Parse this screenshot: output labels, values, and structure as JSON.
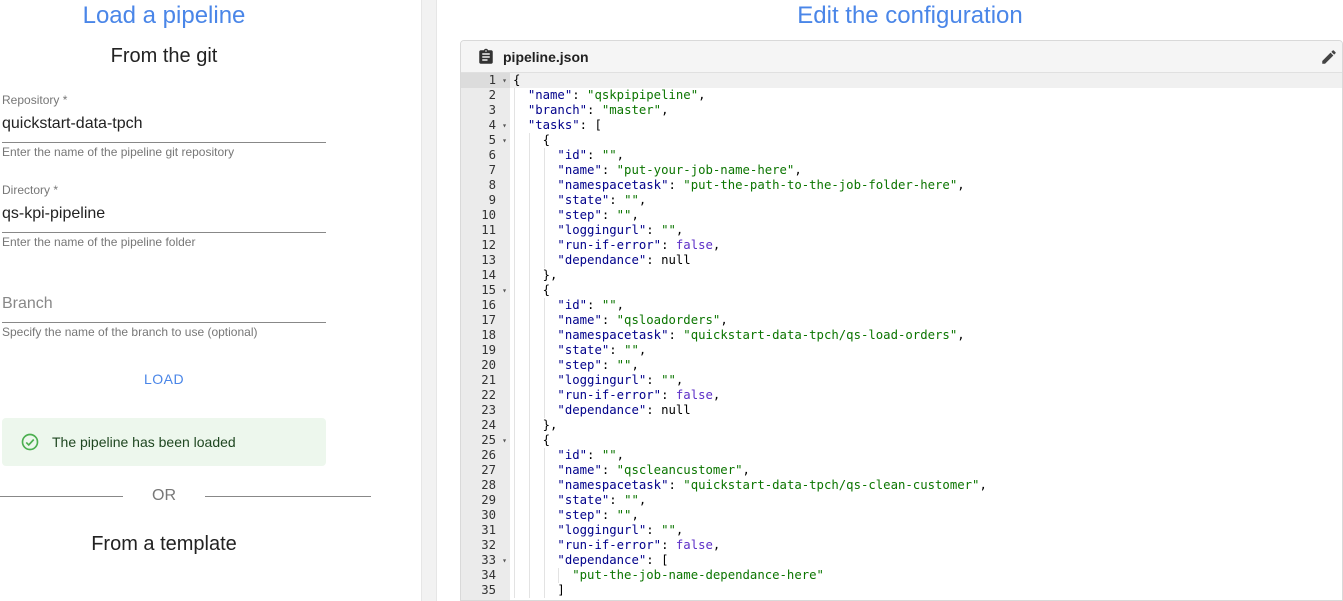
{
  "left": {
    "title": "Load a pipeline",
    "git_title": "From the git",
    "repository": {
      "label": "Repository *",
      "value": "quickstart-data-tpch",
      "helper": "Enter the name of the pipeline git repository"
    },
    "directory": {
      "label": "Directory *",
      "value": "qs-kpi-pipeline",
      "helper": "Enter the name of the pipeline folder"
    },
    "branch": {
      "placeholder": "Branch",
      "helper": "Specify the name of the branch to use (optional)"
    },
    "load_label": "LOAD",
    "alert_text": "The pipeline has been loaded",
    "or_label": "OR",
    "template_title": "From a template"
  },
  "right": {
    "title": "Edit the configuration",
    "file_name": "pipeline.json",
    "colors": {
      "key": "#00008b",
      "string": "#0b7500",
      "boolean": "#5c2ec7",
      "accent": "#4a86e8"
    },
    "code_lines": [
      {
        "n": "1",
        "fold": true,
        "indent": 0,
        "tokens": [
          [
            "p",
            "{"
          ]
        ]
      },
      {
        "n": "2",
        "indent": 1,
        "tokens": [
          [
            "k",
            "\"name\""
          ],
          [
            "p",
            ": "
          ],
          [
            "s",
            "\"qskpipipeline\""
          ],
          [
            "p",
            ","
          ]
        ]
      },
      {
        "n": "3",
        "indent": 1,
        "tokens": [
          [
            "k",
            "\"branch\""
          ],
          [
            "p",
            ": "
          ],
          [
            "s",
            "\"master\""
          ],
          [
            "p",
            ","
          ]
        ]
      },
      {
        "n": "4",
        "fold": true,
        "indent": 1,
        "tokens": [
          [
            "k",
            "\"tasks\""
          ],
          [
            "p",
            ": ["
          ]
        ]
      },
      {
        "n": "5",
        "fold": true,
        "indent": 2,
        "tokens": [
          [
            "p",
            "{"
          ]
        ]
      },
      {
        "n": "6",
        "indent": 3,
        "tokens": [
          [
            "k",
            "\"id\""
          ],
          [
            "p",
            ": "
          ],
          [
            "s",
            "\"\""
          ],
          [
            "p",
            ","
          ]
        ]
      },
      {
        "n": "7",
        "indent": 3,
        "tokens": [
          [
            "k",
            "\"name\""
          ],
          [
            "p",
            ": "
          ],
          [
            "s",
            "\"put-your-job-name-here\""
          ],
          [
            "p",
            ","
          ]
        ]
      },
      {
        "n": "8",
        "indent": 3,
        "tokens": [
          [
            "k",
            "\"namespacetask\""
          ],
          [
            "p",
            ": "
          ],
          [
            "s",
            "\"put-the-path-to-the-job-folder-here\""
          ],
          [
            "p",
            ","
          ]
        ]
      },
      {
        "n": "9",
        "indent": 3,
        "tokens": [
          [
            "k",
            "\"state\""
          ],
          [
            "p",
            ": "
          ],
          [
            "s",
            "\"\""
          ],
          [
            "p",
            ","
          ]
        ]
      },
      {
        "n": "10",
        "indent": 3,
        "tokens": [
          [
            "k",
            "\"step\""
          ],
          [
            "p",
            ": "
          ],
          [
            "s",
            "\"\""
          ],
          [
            "p",
            ","
          ]
        ]
      },
      {
        "n": "11",
        "indent": 3,
        "tokens": [
          [
            "k",
            "\"loggingurl\""
          ],
          [
            "p",
            ": "
          ],
          [
            "s",
            "\"\""
          ],
          [
            "p",
            ","
          ]
        ]
      },
      {
        "n": "12",
        "indent": 3,
        "tokens": [
          [
            "k",
            "\"run-if-error\""
          ],
          [
            "p",
            ": "
          ],
          [
            "b",
            "false"
          ],
          [
            "p",
            ","
          ]
        ]
      },
      {
        "n": "13",
        "indent": 3,
        "tokens": [
          [
            "k",
            "\"dependance\""
          ],
          [
            "p",
            ": null"
          ]
        ]
      },
      {
        "n": "14",
        "indent": 2,
        "tokens": [
          [
            "p",
            "},"
          ]
        ]
      },
      {
        "n": "15",
        "fold": true,
        "indent": 2,
        "tokens": [
          [
            "p",
            "{"
          ]
        ]
      },
      {
        "n": "16",
        "indent": 3,
        "tokens": [
          [
            "k",
            "\"id\""
          ],
          [
            "p",
            ": "
          ],
          [
            "s",
            "\"\""
          ],
          [
            "p",
            ","
          ]
        ]
      },
      {
        "n": "17",
        "indent": 3,
        "tokens": [
          [
            "k",
            "\"name\""
          ],
          [
            "p",
            ": "
          ],
          [
            "s",
            "\"qsloadorders\""
          ],
          [
            "p",
            ","
          ]
        ]
      },
      {
        "n": "18",
        "indent": 3,
        "tokens": [
          [
            "k",
            "\"namespacetask\""
          ],
          [
            "p",
            ": "
          ],
          [
            "s",
            "\"quickstart-data-tpch/qs-load-orders\""
          ],
          [
            "p",
            ","
          ]
        ]
      },
      {
        "n": "19",
        "indent": 3,
        "tokens": [
          [
            "k",
            "\"state\""
          ],
          [
            "p",
            ": "
          ],
          [
            "s",
            "\"\""
          ],
          [
            "p",
            ","
          ]
        ]
      },
      {
        "n": "20",
        "indent": 3,
        "tokens": [
          [
            "k",
            "\"step\""
          ],
          [
            "p",
            ": "
          ],
          [
            "s",
            "\"\""
          ],
          [
            "p",
            ","
          ]
        ]
      },
      {
        "n": "21",
        "indent": 3,
        "tokens": [
          [
            "k",
            "\"loggingurl\""
          ],
          [
            "p",
            ": "
          ],
          [
            "s",
            "\"\""
          ],
          [
            "p",
            ","
          ]
        ]
      },
      {
        "n": "22",
        "indent": 3,
        "tokens": [
          [
            "k",
            "\"run-if-error\""
          ],
          [
            "p",
            ": "
          ],
          [
            "b",
            "false"
          ],
          [
            "p",
            ","
          ]
        ]
      },
      {
        "n": "23",
        "indent": 3,
        "tokens": [
          [
            "k",
            "\"dependance\""
          ],
          [
            "p",
            ": null"
          ]
        ]
      },
      {
        "n": "24",
        "indent": 2,
        "tokens": [
          [
            "p",
            "},"
          ]
        ]
      },
      {
        "n": "25",
        "fold": true,
        "indent": 2,
        "tokens": [
          [
            "p",
            "{"
          ]
        ]
      },
      {
        "n": "26",
        "indent": 3,
        "tokens": [
          [
            "k",
            "\"id\""
          ],
          [
            "p",
            ": "
          ],
          [
            "s",
            "\"\""
          ],
          [
            "p",
            ","
          ]
        ]
      },
      {
        "n": "27",
        "indent": 3,
        "tokens": [
          [
            "k",
            "\"name\""
          ],
          [
            "p",
            ": "
          ],
          [
            "s",
            "\"qscleancustomer\""
          ],
          [
            "p",
            ","
          ]
        ]
      },
      {
        "n": "28",
        "indent": 3,
        "tokens": [
          [
            "k",
            "\"namespacetask\""
          ],
          [
            "p",
            ": "
          ],
          [
            "s",
            "\"quickstart-data-tpch/qs-clean-customer\""
          ],
          [
            "p",
            ","
          ]
        ]
      },
      {
        "n": "29",
        "indent": 3,
        "tokens": [
          [
            "k",
            "\"state\""
          ],
          [
            "p",
            ": "
          ],
          [
            "s",
            "\"\""
          ],
          [
            "p",
            ","
          ]
        ]
      },
      {
        "n": "30",
        "indent": 3,
        "tokens": [
          [
            "k",
            "\"step\""
          ],
          [
            "p",
            ": "
          ],
          [
            "s",
            "\"\""
          ],
          [
            "p",
            ","
          ]
        ]
      },
      {
        "n": "31",
        "indent": 3,
        "tokens": [
          [
            "k",
            "\"loggingurl\""
          ],
          [
            "p",
            ": "
          ],
          [
            "s",
            "\"\""
          ],
          [
            "p",
            ","
          ]
        ]
      },
      {
        "n": "32",
        "indent": 3,
        "tokens": [
          [
            "k",
            "\"run-if-error\""
          ],
          [
            "p",
            ": "
          ],
          [
            "b",
            "false"
          ],
          [
            "p",
            ","
          ]
        ]
      },
      {
        "n": "33",
        "fold": true,
        "indent": 3,
        "tokens": [
          [
            "k",
            "\"dependance\""
          ],
          [
            "p",
            ": ["
          ]
        ]
      },
      {
        "n": "34",
        "indent": 4,
        "tokens": [
          [
            "s",
            "\"put-the-job-name-dependance-here\""
          ]
        ]
      },
      {
        "n": "35",
        "indent": 3,
        "tokens": [
          [
            "p",
            "]"
          ]
        ]
      }
    ]
  }
}
